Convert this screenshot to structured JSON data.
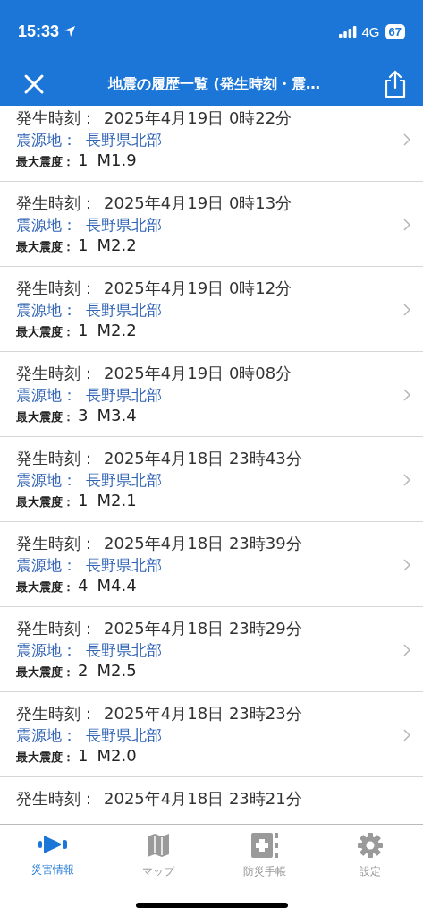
{
  "status_bar": {
    "time": "15:33",
    "network": "4G",
    "battery": "67"
  },
  "nav": {
    "title": "地震の履歴一覧 (発生時刻・震…"
  },
  "quakes": [
    {
      "time_label": "発生時刻：",
      "time": "2025年4月19日 0時22分",
      "epicenter_label": "震源地：",
      "epicenter": "長野県北部",
      "intensity_label": "最大震度：",
      "intensity": "1",
      "magnitude": "M1.9"
    },
    {
      "time_label": "発生時刻：",
      "time": "2025年4月19日 0時13分",
      "epicenter_label": "震源地：",
      "epicenter": "長野県北部",
      "intensity_label": "最大震度：",
      "intensity": "1",
      "magnitude": "M2.2"
    },
    {
      "time_label": "発生時刻：",
      "time": "2025年4月19日 0時12分",
      "epicenter_label": "震源地：",
      "epicenter": "長野県北部",
      "intensity_label": "最大震度：",
      "intensity": "1",
      "magnitude": "M2.2"
    },
    {
      "time_label": "発生時刻：",
      "time": "2025年4月19日 0時08分",
      "epicenter_label": "震源地：",
      "epicenter": "長野県北部",
      "intensity_label": "最大震度：",
      "intensity": "3",
      "magnitude": "M3.4"
    },
    {
      "time_label": "発生時刻：",
      "time": "2025年4月18日 23時43分",
      "epicenter_label": "震源地：",
      "epicenter": "長野県北部",
      "intensity_label": "最大震度：",
      "intensity": "1",
      "magnitude": "M2.1"
    },
    {
      "time_label": "発生時刻：",
      "time": "2025年4月18日 23時39分",
      "epicenter_label": "震源地：",
      "epicenter": "長野県北部",
      "intensity_label": "最大震度：",
      "intensity": "4",
      "magnitude": "M4.4"
    },
    {
      "time_label": "発生時刻：",
      "time": "2025年4月18日 23時29分",
      "epicenter_label": "震源地：",
      "epicenter": "長野県北部",
      "intensity_label": "最大震度：",
      "intensity": "2",
      "magnitude": "M2.5"
    },
    {
      "time_label": "発生時刻：",
      "time": "2025年4月18日 23時23分",
      "epicenter_label": "震源地：",
      "epicenter": "長野県北部",
      "intensity_label": "最大震度：",
      "intensity": "1",
      "magnitude": "M2.0"
    },
    {
      "time_label": "発生時刻：",
      "time": "2025年4月18日 23時21分"
    }
  ],
  "tabs": [
    {
      "kind": "alert",
      "label": "災害情報",
      "selected": true
    },
    {
      "kind": "map",
      "label": "マップ",
      "selected": false
    },
    {
      "kind": "handbook",
      "label": "防災手帳",
      "selected": false
    },
    {
      "kind": "settings",
      "label": "設定",
      "selected": false
    }
  ]
}
